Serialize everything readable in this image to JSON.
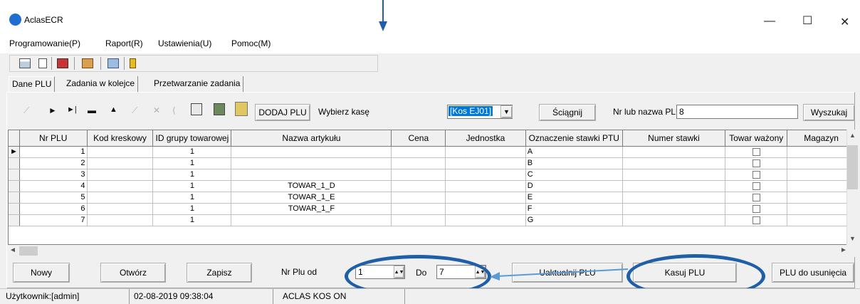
{
  "window": {
    "title": "AclasECR",
    "minimize": "—",
    "maximize": "☐",
    "close": "✕"
  },
  "menu": [
    "Programowanie(P)",
    "Raport(R)",
    "Ustawienia(U)",
    "Pomoc(M)"
  ],
  "toolbar": {
    "icons": [
      "grid-icon",
      "document-icon",
      "flag-icon",
      "people-icon",
      "transfer-icon",
      "exit-icon"
    ]
  },
  "tabs": [
    "Dane PLU",
    "Zadania w kolejce",
    "Przetwarzanie zadania"
  ],
  "nav": {
    "dodaj_plu": "DODAJ PLU",
    "wybierz_kase_label": "Wybierz kasę",
    "kasa_selected": "[Kos EJ01]",
    "sciagnij": "Ściągnij",
    "nr_lub_nazwa_label": "Nr lub nazwa PLU",
    "search_value": "8",
    "wyszukaj": "Wyszukaj"
  },
  "grid": {
    "columns": [
      "Nr PLU",
      "Kod kreskowy",
      "ID grupy towarowej",
      "Nazwa artykułu",
      "Cena",
      "Jednostka",
      "Oznaczenie stawki PTU",
      "Numer stawki",
      "Towar ważony",
      "Magazyn"
    ],
    "rows": [
      {
        "nr": "1",
        "kod": "",
        "grupa": "1",
        "nazwa": "",
        "cena": "",
        "jedn": "",
        "ptu": "A",
        "numer": "",
        "magazyn": ""
      },
      {
        "nr": "2",
        "kod": "",
        "grupa": "1",
        "nazwa": "",
        "cena": "",
        "jedn": "",
        "ptu": "B",
        "numer": "",
        "magazyn": ""
      },
      {
        "nr": "3",
        "kod": "",
        "grupa": "1",
        "nazwa": "",
        "cena": "",
        "jedn": "",
        "ptu": "C",
        "numer": "",
        "magazyn": ""
      },
      {
        "nr": "4",
        "kod": "",
        "grupa": "1",
        "nazwa": "TOWAR_1_D",
        "cena": "",
        "jedn": "",
        "ptu": "D",
        "numer": "",
        "magazyn": ""
      },
      {
        "nr": "5",
        "kod": "",
        "grupa": "1",
        "nazwa": "TOWAR_1_E",
        "cena": "",
        "jedn": "",
        "ptu": "E",
        "numer": "",
        "magazyn": ""
      },
      {
        "nr": "6",
        "kod": "",
        "grupa": "1",
        "nazwa": "TOWAR_1_F",
        "cena": "",
        "jedn": "",
        "ptu": "F",
        "numer": "",
        "magazyn": ""
      },
      {
        "nr": "7",
        "kod": "",
        "grupa": "1",
        "nazwa": "",
        "cena": "",
        "jedn": "",
        "ptu": "G",
        "numer": "",
        "magazyn": ""
      }
    ]
  },
  "bottom": {
    "nowy": "Nowy",
    "otworz": "Otwórz",
    "zapisz": "Zapisz",
    "nr_plu_od_label": "Nr Plu od",
    "od_value": "1",
    "do_label": "Do",
    "do_value": "7",
    "uaktualnij": "Uaktualnij PLU",
    "kasuj": "Kasuj PLU",
    "do_usuniecia": "PLU do usunięcia"
  },
  "status": {
    "user": "Użytkownik:[admin]",
    "datetime": "02-08-2019 09:38:04",
    "connection": "ACLAS KOS ON"
  },
  "colors": {
    "annotation": "#1f5fa8",
    "selection": "#0078d7"
  }
}
